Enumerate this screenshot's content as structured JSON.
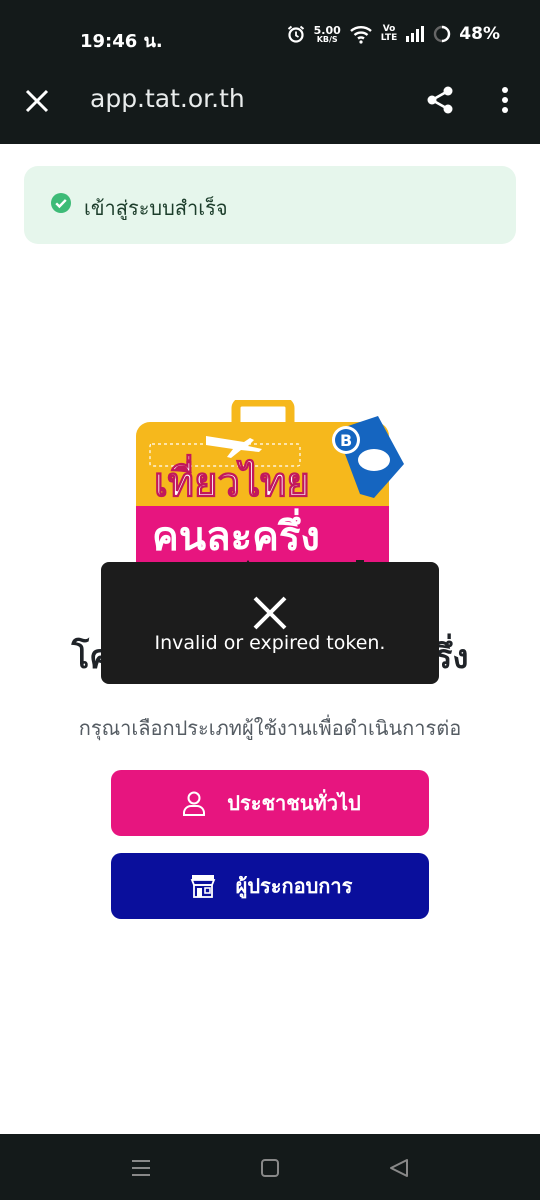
{
  "status_bar": {
    "time": "19:46 น.",
    "data_speed_value": "5.00",
    "data_speed_unit": "KB/S",
    "volte_top": "Vo",
    "volte_bottom": "LTE",
    "battery": "48%"
  },
  "browser": {
    "url": "app.tat.or.th"
  },
  "success_alert": {
    "text": "เข้าสู่ระบบสำเร็จ",
    "color": "#3dbb77"
  },
  "logo": {
    "line1": "เที่ยวไทย",
    "line2": "คนละครึ่ง",
    "badge": "B",
    "colors": {
      "top": "#f6b81c",
      "bottom": "#e7157f",
      "tag": "#1565c0"
    }
  },
  "main": {
    "title": "โครงการเที่ยวไทยคนละครึ่ง",
    "subtitle": "กรุณาเลือกประเภทผู้ใช้งานเพื่อดำเนินการต่อ",
    "buttons": {
      "general": "ประชาชนทั่วไป",
      "operator": "ผู้ประกอบการ"
    }
  },
  "toast": {
    "message": "Invalid or expired token."
  },
  "icons": {
    "close": "close-icon",
    "share": "share-icon",
    "menu": "more-vertical-icon",
    "check": "check-circle-icon",
    "person": "person-icon",
    "store": "store-icon"
  }
}
